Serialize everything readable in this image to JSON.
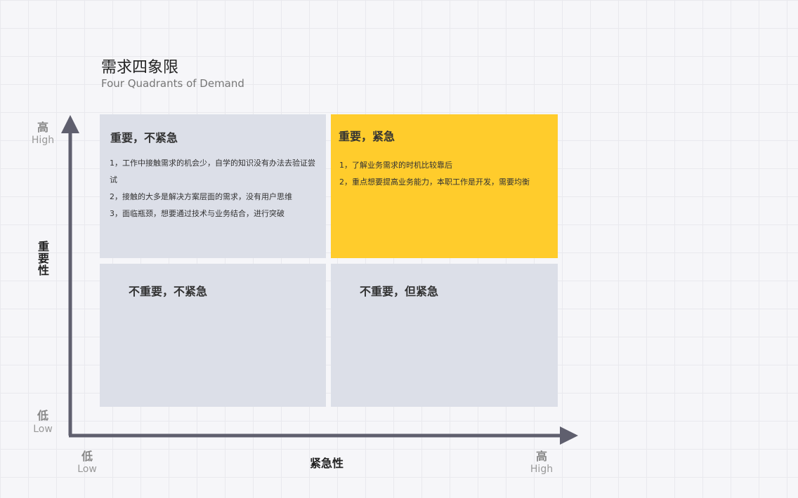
{
  "header": {
    "title": "需求四象限",
    "subtitle": "Four Quadrants of Demand"
  },
  "axes": {
    "y": {
      "name": "重要性",
      "high": "高",
      "high_en": "High",
      "low": "低",
      "low_en": "Low"
    },
    "x": {
      "name": "紧急性",
      "low": "低",
      "low_en": "Low",
      "high": "高",
      "high_en": "High"
    },
    "color": "#5f5f6e"
  },
  "quadrants": {
    "top_left": {
      "heading": "重要，不紧急",
      "items": [
        "1，工作中接触需求的机会少，自学的知识没有办法去验证尝试",
        "2，接触的大多是解决方案层面的需求，没有用户思维",
        "3，面临瓶颈，想要通过技术与业务结合，进行突破"
      ]
    },
    "top_right": {
      "heading": "重要，紧急",
      "items": [
        "1，了解业务需求的时机比较靠后",
        "2，重点想要提高业务能力，本职工作是开发，需要均衡"
      ]
    },
    "bottom_left": {
      "heading": "不重要，不紧急"
    },
    "bottom_right": {
      "heading": "不重要，但紧急"
    }
  },
  "colors": {
    "quadrant_default": "#dcdfe8",
    "quadrant_highlight": "#ffcc2c"
  }
}
